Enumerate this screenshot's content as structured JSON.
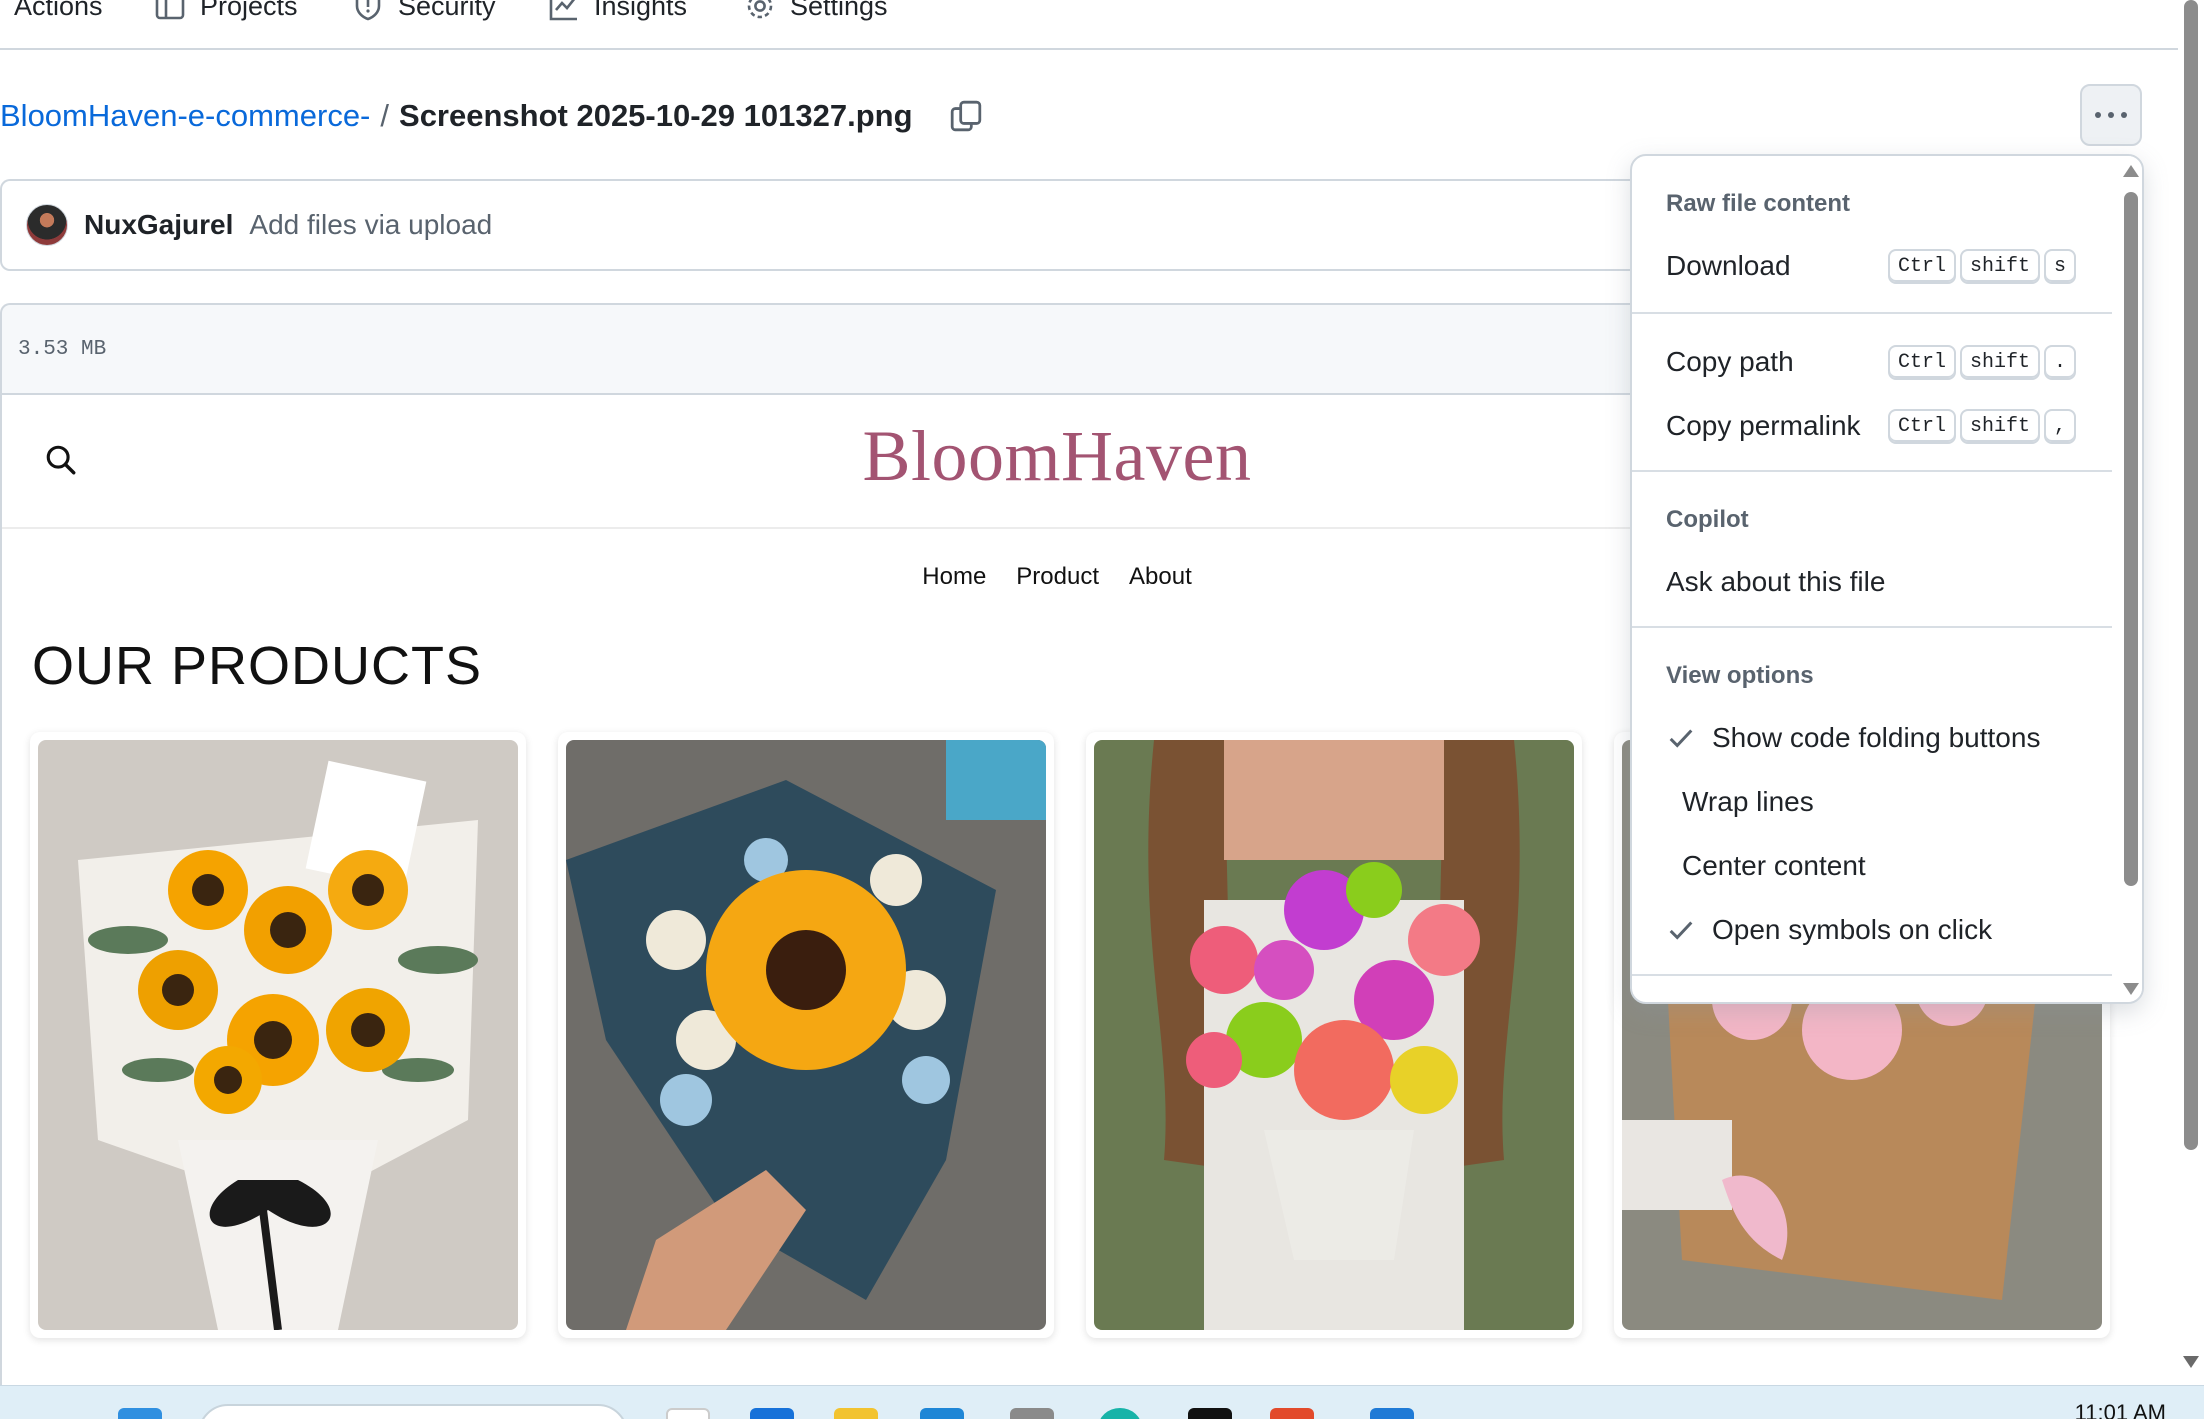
{
  "repo_nav": {
    "tabs": [
      {
        "label": "Actions",
        "icon": "play-circle-icon"
      },
      {
        "label": "Projects",
        "icon": "table-icon"
      },
      {
        "label": "Security",
        "icon": "shield-icon"
      },
      {
        "label": "Insights",
        "icon": "graph-icon"
      },
      {
        "label": "Settings",
        "icon": "gear-icon"
      }
    ]
  },
  "breadcrumb": {
    "repo": "BloomHaven-e-commerce-",
    "separator": "/",
    "file": "Screenshot 2025-10-29 101327.png"
  },
  "commit": {
    "user": "NuxGajurel",
    "message": "Add files via upload"
  },
  "file": {
    "size": "3.53 MB"
  },
  "preview": {
    "logo": "BloomHaven",
    "nav": [
      "Home",
      "Product",
      "About"
    ],
    "section_title": "OUR PRODUCTS",
    "products": [
      {
        "image": "sunflower-bouquet-white-wrap"
      },
      {
        "image": "sunflower-bouquet-blue-wrap"
      },
      {
        "image": "mixed-pink-bouquet"
      },
      {
        "image": "pink-carnation-kraft-wrap"
      }
    ]
  },
  "menu": {
    "raw_label": "Raw file content",
    "download": {
      "label": "Download",
      "keys": [
        "Ctrl",
        "shift",
        "s"
      ]
    },
    "copy_path": {
      "label": "Copy path",
      "keys": [
        "Ctrl",
        "shift",
        "."
      ]
    },
    "copy_permalink": {
      "label": "Copy permalink",
      "keys": [
        "Ctrl",
        "shift",
        ","
      ]
    },
    "copilot_label": "Copilot",
    "ask": "Ask about this file",
    "view_label": "View options",
    "options": [
      {
        "label": "Show code folding buttons",
        "checked": true
      },
      {
        "label": "Wrap lines",
        "checked": false
      },
      {
        "label": "Center content",
        "checked": false
      },
      {
        "label": "Open symbols on click",
        "checked": true
      }
    ]
  },
  "taskbar": {
    "clock": "11:01 AM"
  },
  "colors": {
    "link": "#0969da",
    "logo": "#a35472",
    "border": "#d0d7de"
  }
}
